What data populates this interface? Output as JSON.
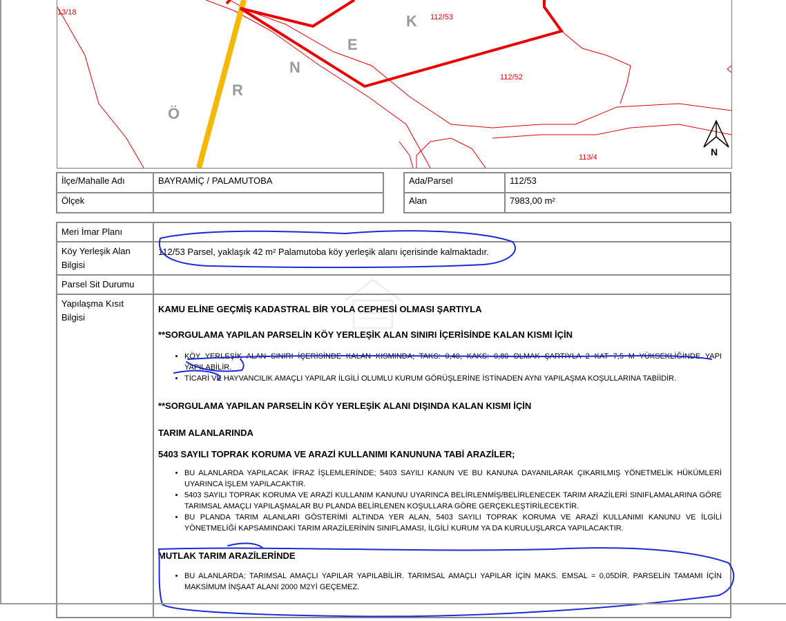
{
  "map": {
    "parcel_labels": [
      "13/18",
      "112/53",
      "112/52",
      "113/4"
    ],
    "village_letters": [
      "Ö",
      "R",
      "N",
      "E",
      "K"
    ],
    "north_label": "N",
    "colors": {
      "parcel_lines": "#e00000",
      "road": "#f5b800",
      "highlight": "#e80000"
    }
  },
  "info_left": [
    {
      "label": "İlçe/Mahalle Adı",
      "value": "BAYRAMİÇ / PALAMUTOBA"
    },
    {
      "label": "Ölçek",
      "value": ""
    }
  ],
  "info_right": [
    {
      "label": "Ada/Parsel",
      "value": "112/53"
    },
    {
      "label": "Alan",
      "value": "7983,00 m²"
    }
  ],
  "main": {
    "rows": [
      {
        "label": "Meri İmar Planı",
        "value": ""
      },
      {
        "label": "Köy Yerleşik Alan Bilgisi",
        "value": "112/53 Parsel, yaklaşık 42 m² Palamutoba köy yerleşik alanı içerisinde kalmaktadır."
      },
      {
        "label": "Parsel Sit Durumu",
        "value": ""
      },
      {
        "label": "Yapılaşma Kısıt Bilgisi"
      }
    ],
    "restrictions": {
      "h1": "KAMU ELİNE GEÇMİŞ KADASTRAL BİR YOLA CEPHESİ OLMASI ŞARTIYLA",
      "h2": "**SORGULAMA YAPILAN PARSELİN KÖY YERLEŞİK ALAN SINIRI İÇERİSİNDE KALAN KISMI İÇİN",
      "list1": [
        "KÖY YERLEŞİK ALAN SINIRI İÇERİSİNDE KALAN KISMINDA; TAKS: 0,40, KAKS: 0,80 OLMAK ŞARTIYLA 2 KAT 7,5 M YÜKSEKLİĞİNDE YAPI YAPILABİLİR.",
        "TİCARİ VE HAYVANCILIK AMAÇLI YAPILAR İLGİLİ OLUMLU KURUM GÖRÜŞLERİNE İSTİNADEN AYNI YAPILAŞMA KOŞULLARINA TABİİDİR."
      ],
      "h3": "**SORGULAMA YAPILAN PARSELİN KÖY YERLEŞİK ALANI DIŞINDA KALAN KISMI İÇİN",
      "h4": "TARIM ALANLARINDA",
      "h5": "5403 SAYILI TOPRAK KORUMA VE ARAZİ KULLANIMI KANUNUNA TABİ ARAZİLER;",
      "list2": [
        "BU ALANLARDA YAPILACAK İFRAZ İŞLEMLERİNDE; 5403 SAYILI KANUN VE BU KANUNA DAYANILARAK ÇIKARILMIŞ YÖNETMELİK HÜKÜMLERİ UYARINCA İŞLEM YAPILACAKTIR.",
        "5403 SAYILI TOPRAK KORUMA VE ARAZİ KULLANIM KANUNU UYARINCA BELİRLENMİŞ/BELİRLENECEK TARIM ARAZİLERİ SINIFLAMALARINA GÖRE TARIMSAL AMAÇLI YAPILAŞMALAR BU PLANDA BELİRLENEN KOŞULLARA GÖRE GERÇEKLEŞTİRİLECEKTİR.",
        "BU PLANDA TARIM ALANLARI GÖSTERİMİ ALTINDA YER ALAN, 5403 SAYILI TOPRAK KORUMA VE ARAZİ KULLANIMI KANUNU VE İLGİLİ YÖNETMELİĞİ KAPSAMINDAKİ TARIM ARAZİLERİNİN SINIFLAMASI, İLGİLİ KURUM YA DA KURULUŞLARCA YAPILACAKTIR."
      ],
      "h6": "MUTLAK TARIM ARAZİLERİNDE",
      "list3": [
        "BU ALANLARDA; TARIMSAL AMAÇLI YAPILAR YAPILABİLİR. TARIMSAL AMAÇLI YAPILAR İÇİN MAKS. EMSAL = 0,05DİR. PARSELİN TAMAMI İÇİN MAKSİMUM İNŞAAT ALANI 2000 M2Yİ GEÇEMEZ."
      ]
    }
  },
  "annotations": {
    "pen_color": "#1a2ad6"
  }
}
